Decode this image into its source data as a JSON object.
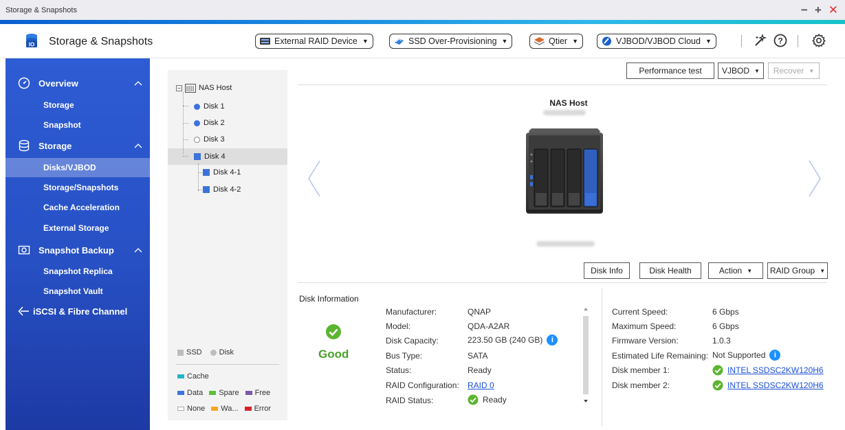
{
  "window": {
    "title": "Storage & Snapshots"
  },
  "app": {
    "title": "Storage & Snapshots"
  },
  "header": {
    "dropdowns": [
      {
        "label": "External RAID Device"
      },
      {
        "label": "SSD Over-Provisioning"
      },
      {
        "label": "Qtier"
      },
      {
        "label": "VJBOD/VJBOD Cloud"
      }
    ]
  },
  "sidebar": {
    "sections": [
      {
        "label": "Overview",
        "items": [
          "Storage",
          "Snapshot"
        ]
      },
      {
        "label": "Storage",
        "items": [
          "Disks/VJBOD",
          "Storage/Snapshots",
          "Cache Acceleration",
          "External Storage"
        ]
      },
      {
        "label": "Snapshot Backup",
        "items": [
          "Snapshot Replica",
          "Snapshot Vault"
        ]
      },
      {
        "label": "iSCSI & Fibre Channel",
        "items": []
      }
    ],
    "active_item": "Disks/VJBOD"
  },
  "tree": {
    "root": "NAS Host",
    "nodes": [
      "Disk 1",
      "Disk 2",
      "Disk 3",
      "Disk 4",
      "Disk 4-1",
      "Disk 4-2"
    ]
  },
  "legend": {
    "ssd": "SSD",
    "disk": "Disk",
    "cache": "Cache",
    "data": "Data",
    "spare": "Spare",
    "free": "Free",
    "none": "None",
    "warning": "Wa...",
    "error": "Error",
    "colors": {
      "ssd": "#bdbdbd",
      "disk": "#bdbdbd",
      "cache": "#1fb6c9",
      "data": "#3c73db",
      "spare": "#5bc236",
      "free": "#7a5aa8",
      "none": "#ffffff",
      "warning": "#f5a623",
      "error": "#d8202a"
    }
  },
  "toolbar": {
    "performance_test": "Performance test",
    "vjbod": "VJBOD",
    "recover": "Recover"
  },
  "enclosure": {
    "title": "NAS Host"
  },
  "disk_actions": {
    "disk_info": "Disk Info",
    "disk_health": "Disk Health",
    "action": "Action",
    "raid_group": "RAID Group"
  },
  "disk_info": {
    "title": "Disk Information",
    "status_label": "Good",
    "left": [
      {
        "key": "Manufacturer:",
        "value": "QNAP"
      },
      {
        "key": "Model:",
        "value": "QDA-A2AR"
      },
      {
        "key": "Disk Capacity:",
        "value": "223.50 GB (240 GB)"
      },
      {
        "key": "Bus Type:",
        "value": "SATA"
      },
      {
        "key": "Status:",
        "value": "Ready"
      },
      {
        "key": "RAID Configuration:",
        "value": "RAID 0"
      },
      {
        "key": "RAID Status:",
        "value": "Ready"
      }
    ],
    "right": [
      {
        "key": "Current Speed:",
        "value": "6 Gbps"
      },
      {
        "key": "Maximum Speed:",
        "value": "6 Gbps"
      },
      {
        "key": "Firmware Version:",
        "value": "1.0.3"
      },
      {
        "key": "Estimated Life Remaining:",
        "value": "Not Supported"
      },
      {
        "key": "Disk member 1:",
        "value": "INTEL SSDSC2KW120H6"
      },
      {
        "key": "Disk member 2:",
        "value": "INTEL SSDSC2KW120H6"
      }
    ]
  },
  "colors": {
    "accent": "#2750c4",
    "good": "#4aa02c",
    "link": "#1a4fd6"
  }
}
